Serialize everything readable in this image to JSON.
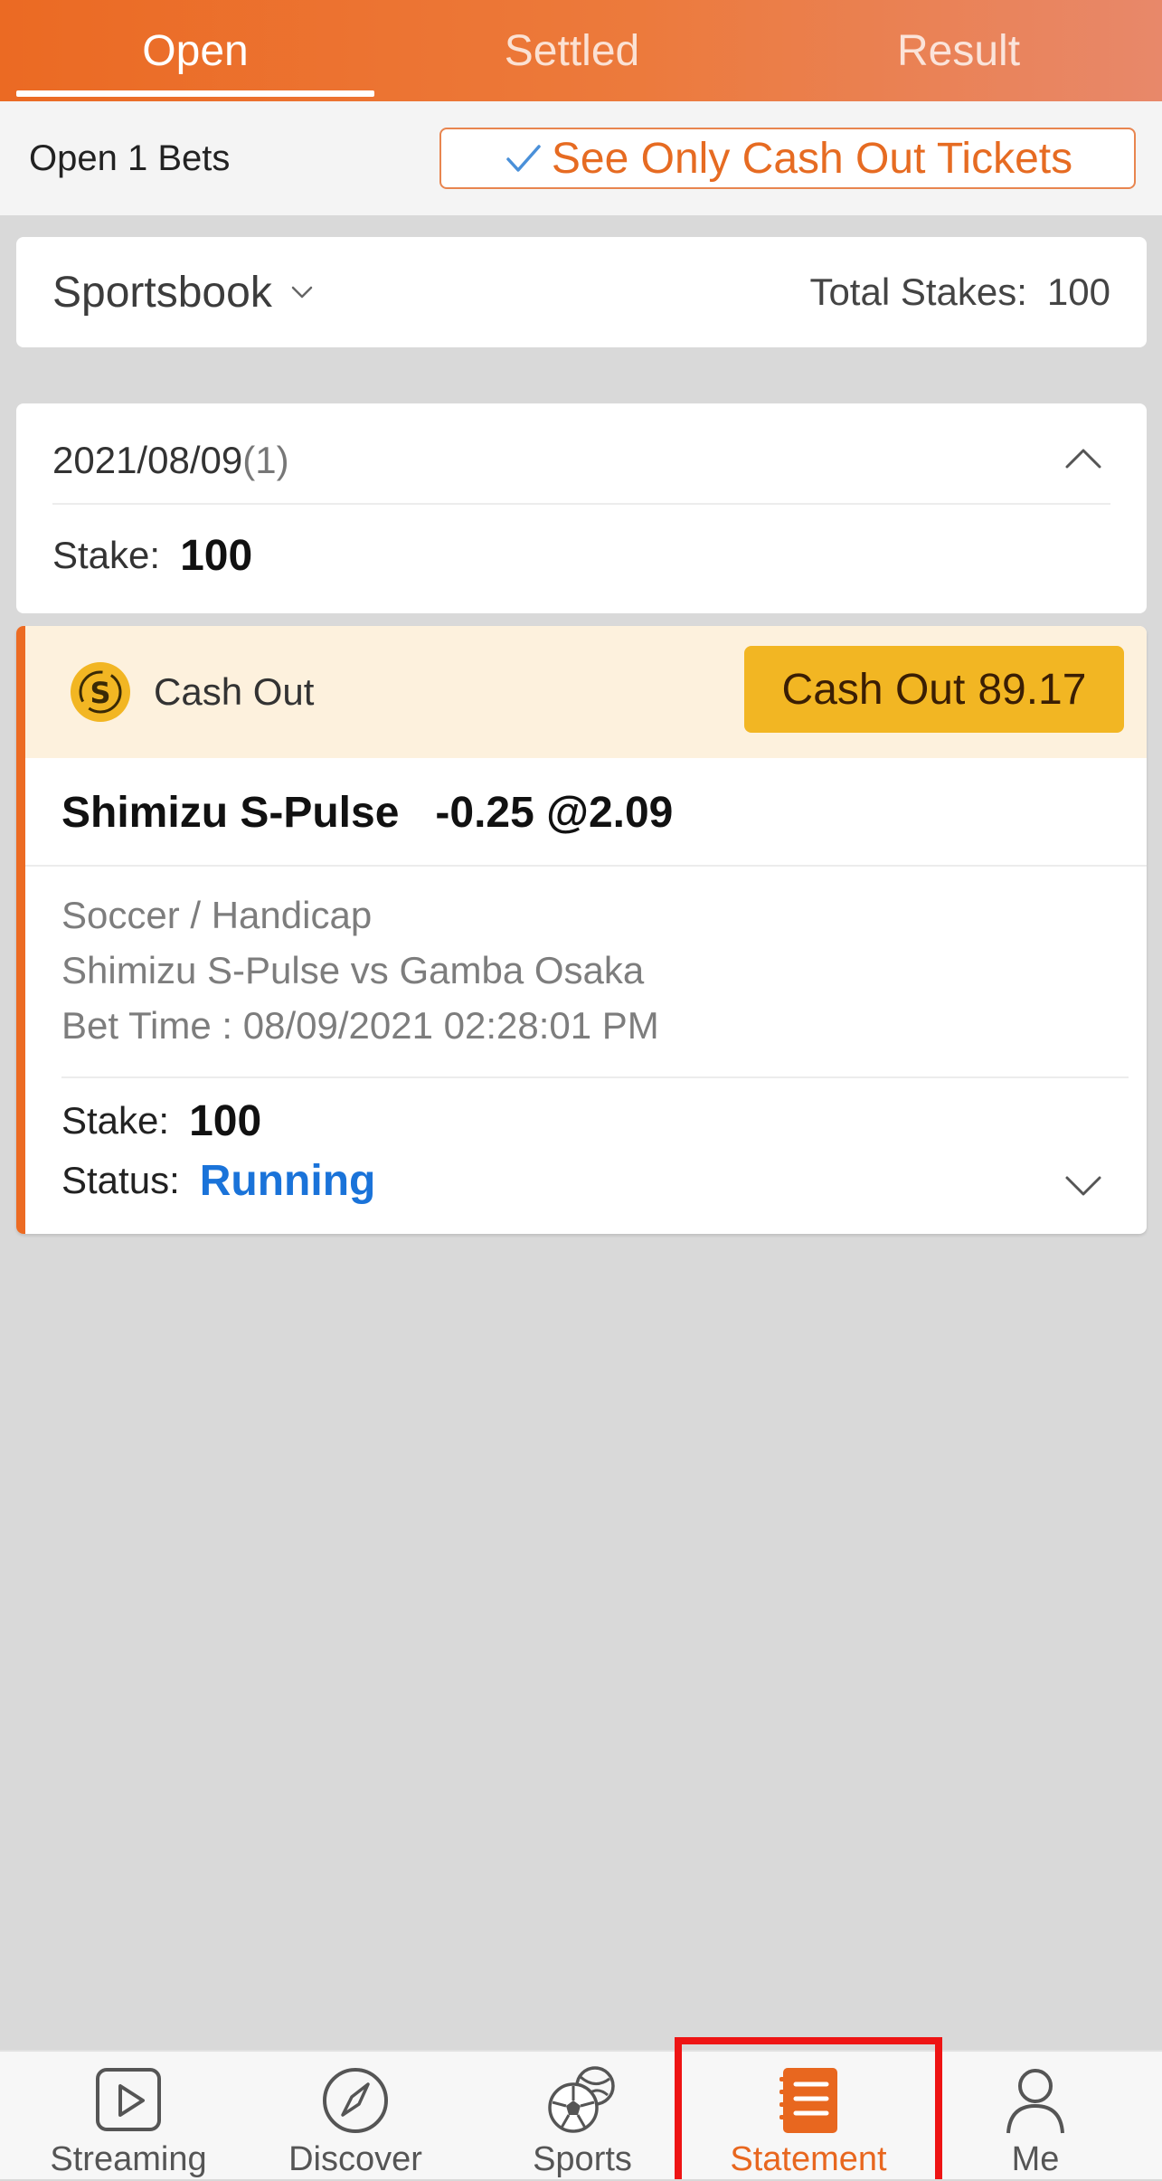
{
  "tabs": [
    {
      "label": "Open",
      "active": true
    },
    {
      "label": "Settled",
      "active": false
    },
    {
      "label": "Result",
      "active": false
    }
  ],
  "filter_bar": {
    "open_count": "Open 1 Bets",
    "cashout_filter_label": "See Only Cash Out Tickets"
  },
  "sportsbook": {
    "label": "Sportsbook",
    "total_stakes_label": "Total Stakes:",
    "total_stakes_value": "100"
  },
  "date_group": {
    "date": "2021/08/09",
    "count": "(1)",
    "stake_label": "Stake:",
    "stake_value": "100"
  },
  "ticket": {
    "cashout_label": "Cash Out",
    "cashout_button_label": "Cash Out",
    "cashout_amount": "89.17",
    "selection": "Shimizu S-Pulse",
    "handicap_odds": "-0.25 @2.09",
    "sport_market": "Soccer / Handicap",
    "match": "Shimizu S-Pulse vs Gamba Osaka",
    "bet_time": "Bet Time : 08/09/2021 02:28:01 PM",
    "stake_label": "Stake:",
    "stake_value": "100",
    "status_label": "Status:",
    "status_value": "Running",
    "status_color": "#1a73d9"
  },
  "bottom_nav": [
    {
      "label": "Streaming",
      "icon": "play-icon",
      "active": false
    },
    {
      "label": "Discover",
      "icon": "compass-icon",
      "active": false
    },
    {
      "label": "Sports",
      "icon": "sports-balls-icon",
      "active": false
    },
    {
      "label": "Statement",
      "icon": "statement-icon",
      "active": true
    },
    {
      "label": "Me",
      "icon": "person-icon",
      "active": false
    }
  ],
  "colors": {
    "brand_orange": "#eb6a23",
    "cashout_yellow": "#f2b623",
    "highlight_red": "#ee1414"
  }
}
